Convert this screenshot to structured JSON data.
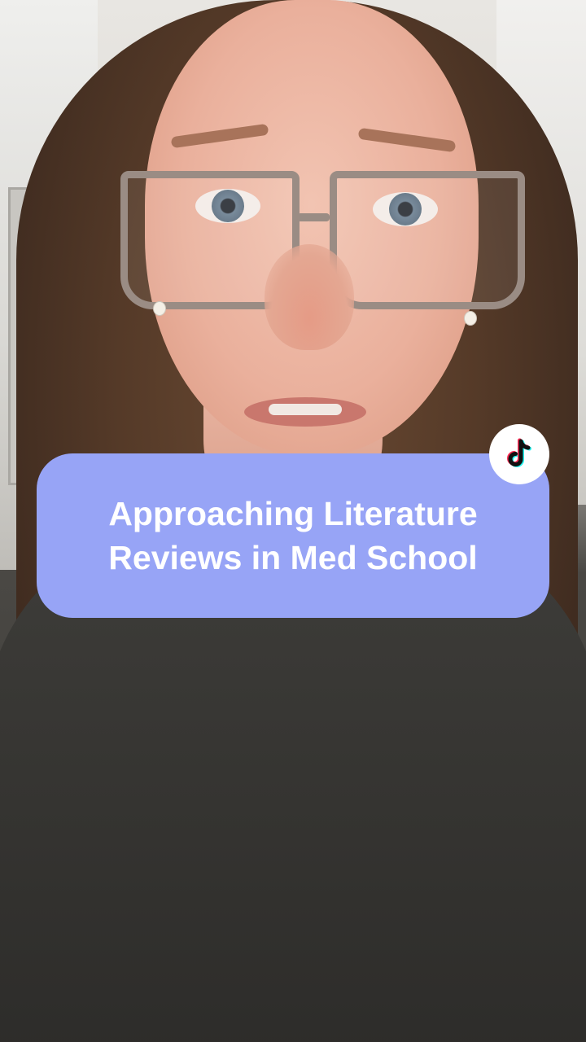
{
  "title_card": {
    "line1": "Approaching Literature",
    "line2": "Reviews in Med School",
    "background_color": "#97a4f6",
    "text_color": "#ffffff"
  },
  "badge": {
    "icon": "tiktok-logo-icon"
  }
}
